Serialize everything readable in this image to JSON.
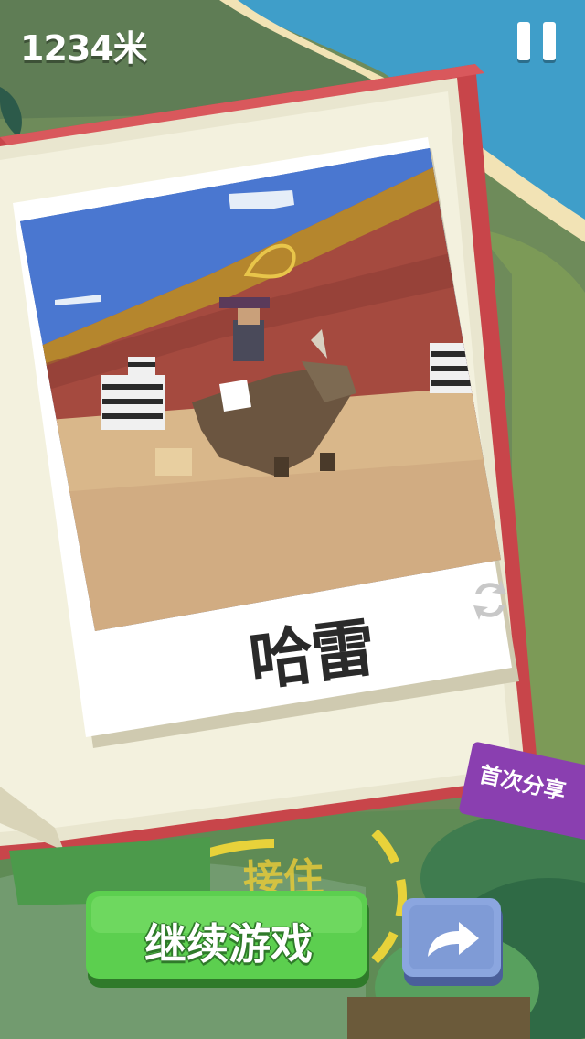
{
  "hud": {
    "distance": "1234米"
  },
  "photo": {
    "animal_name": "哈雷"
  },
  "promo": {
    "text": "首次分享"
  },
  "hint": {
    "catch_text": "接住"
  },
  "buttons": {
    "continue_label": "继续游戏"
  },
  "icons": {
    "pause": "pause-icon",
    "refresh": "refresh-icon",
    "share": "share-arrow-icon"
  },
  "colors": {
    "book_red": "#c8454a",
    "continue_green": "#4fbf45",
    "share_blue": "#7f9bd6",
    "promo_purple": "#8a3fb0",
    "hint_yellow": "#e4c93a"
  }
}
